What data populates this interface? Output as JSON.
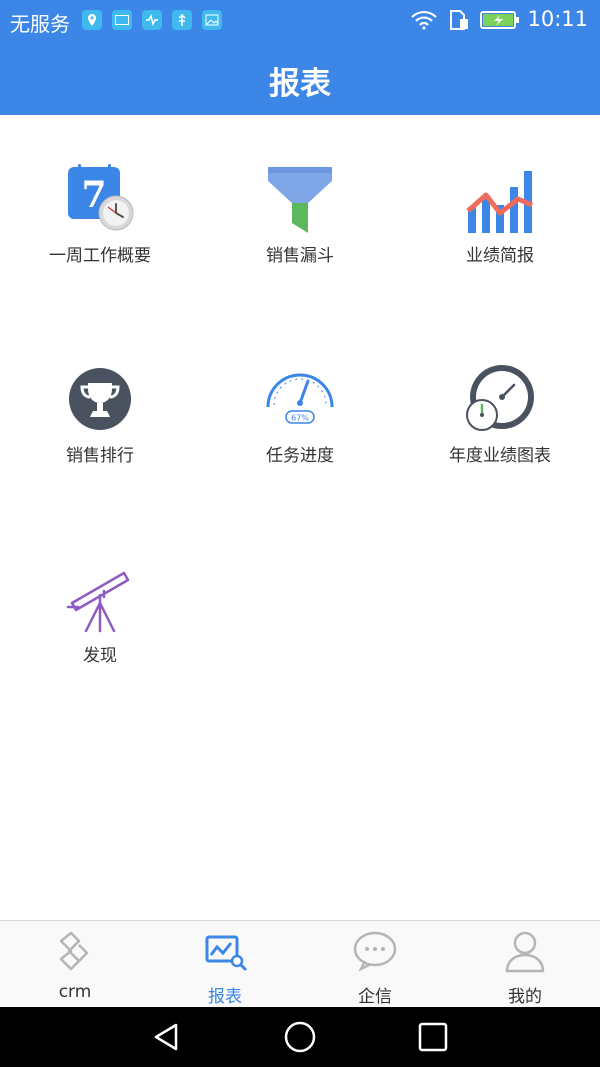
{
  "status_bar": {
    "carrier": "无服务",
    "time": "10:11"
  },
  "header": {
    "title": "报表"
  },
  "tiles": [
    {
      "label": "一周工作概要",
      "icon": "calendar-clock-icon"
    },
    {
      "label": "销售漏斗",
      "icon": "funnel-icon"
    },
    {
      "label": "业绩简报",
      "icon": "bar-line-chart-icon"
    },
    {
      "label": "销售排行",
      "icon": "trophy-icon"
    },
    {
      "label": "任务进度",
      "icon": "gauge-icon",
      "gauge_text": "67%"
    },
    {
      "label": "年度业绩图表",
      "icon": "dial-gauge-icon"
    },
    {
      "label": "发现",
      "icon": "telescope-icon"
    }
  ],
  "tab_bar": {
    "active_color": "#3b86e6",
    "items": [
      {
        "label": "crm",
        "icon": "crm-logo-icon"
      },
      {
        "label": "报表",
        "icon": "report-chart-icon"
      },
      {
        "label": "企信",
        "icon": "chat-bubble-icon"
      },
      {
        "label": "我的",
        "icon": "person-icon"
      }
    ]
  },
  "nav_bar": {
    "buttons": [
      "back",
      "home",
      "recents"
    ]
  }
}
